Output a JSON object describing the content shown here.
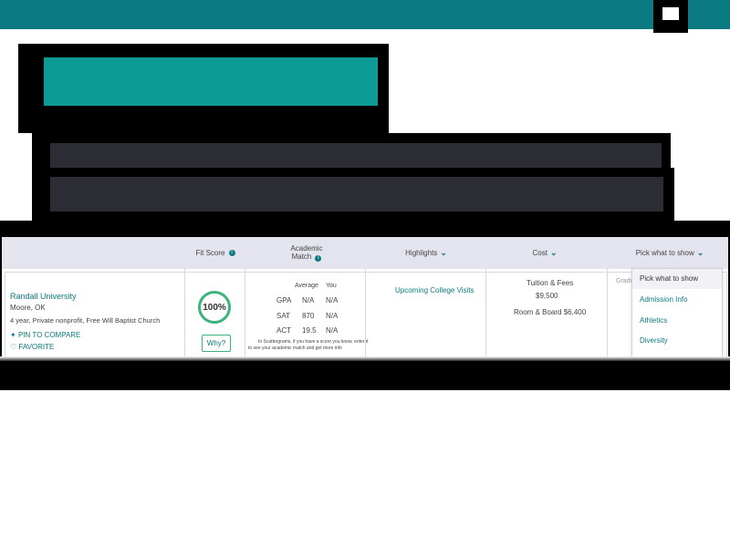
{
  "header": {
    "menu_icon": "menu-icon"
  },
  "table": {
    "headers": {
      "fit_score": "Fit Score",
      "academic_match_line1": "Academic",
      "academic_match_line2": "Match",
      "highlights": "Highlights",
      "cost": "Cost",
      "pick": "Pick what to show"
    },
    "row": {
      "school_name": "Randall University",
      "location": "Moore, OK",
      "details": "4 year, Private nonprofit, Free Will Baptist Church",
      "pin_label": "PIN TO COMPARE",
      "favorite_label": "FAVORITE",
      "fit_score": "100%",
      "why_label": "Why?",
      "academic": {
        "col_average": "Average",
        "col_you": "You",
        "rows": [
          {
            "label": "GPA",
            "average": "N/A",
            "you": "N/A"
          },
          {
            "label": "SAT",
            "average": "870",
            "you": "N/A"
          },
          {
            "label": "ACT",
            "average": "19.5",
            "you": "N/A"
          }
        ],
        "note_line1": "In Scattergrams, if you have a score you know, enter it",
        "note_line2": "to see your academic match and get more info"
      },
      "highlights_link": "Upcoming College Visits",
      "cost": {
        "tuition_label": "Tuition & Fees",
        "tuition_value": "$9,500",
        "room_board": "Room & Board $6,400"
      },
      "pick_partial": "Gradu"
    },
    "dropdown": {
      "items": [
        "Pick what to show",
        "Admission Info",
        "Athletics",
        "Diversity"
      ]
    }
  }
}
